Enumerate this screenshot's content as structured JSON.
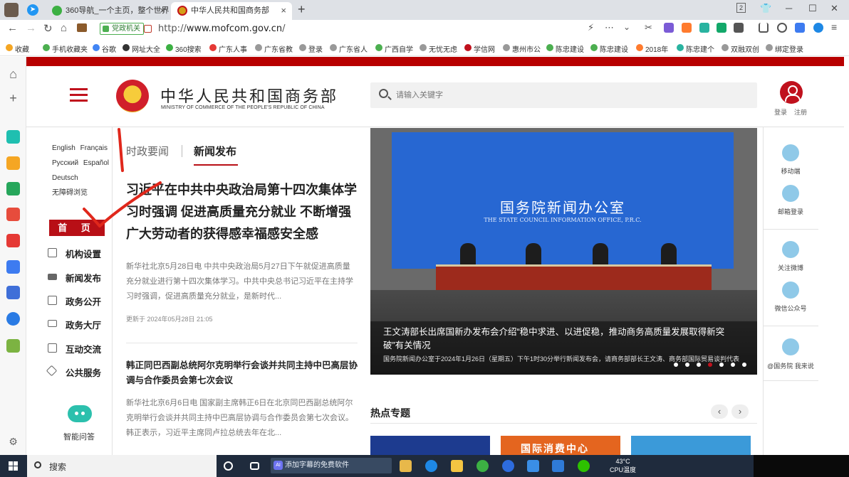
{
  "browser": {
    "tabs": [
      {
        "label": "360导航_一个主页，整个世界",
        "close": "×"
      },
      {
        "label": "中华人民共和国商务部",
        "close": "×"
      }
    ],
    "new_tab": "+",
    "tab_count": "2",
    "window_controls": [
      "─",
      "☐",
      "✕"
    ],
    "security_badge": "党政机关",
    "url_prefix": "http://",
    "url_host": "www.mofcom.gov.cn",
    "url_suffix": "/",
    "bookmarks": [
      "收藏",
      "手机收藏夹",
      "谷歌",
      "网址大全",
      "360搜索",
      "广东人事",
      "广东省教",
      "登录",
      "广东省人",
      "广西自学",
      "无忧无虑",
      "学信网",
      "惠州市公",
      "陈忠建设",
      "陈忠建设",
      "2018年",
      "陈忠建个",
      "双融双创",
      "绑定登录"
    ]
  },
  "site": {
    "logo_cn": "中华人民共和国商务部",
    "logo_en": "MINISTRY OF COMMERCE OF THE PEOPLE'S REPUBLIC OF CHINA",
    "search_placeholder": "请输入关键字",
    "login": "登录",
    "register": "注册",
    "languages": [
      "English",
      "Français",
      "Русский",
      "Español",
      "Deutsch",
      "无障碍浏览"
    ],
    "home": "首 页",
    "left_nav": [
      "机构设置",
      "新闻发布",
      "政务公开",
      "政务大厅",
      "互动交流",
      "公共服务"
    ],
    "ai_label": "智能问答",
    "news_tabs": [
      "时政要闻",
      "新闻发布"
    ],
    "headline": "习近平在中共中央政治局第十四次集体学习时强调 促进高质量充分就业 不断增强广大劳动者的获得感幸福感安全感",
    "summary": "新华社北京5月28日电 中共中央政治局5月27日下午就促进高质量充分就业进行第十四次集体学习。中共中央总书记习近平在主持学习时强调，促进高质量充分就业，是新时代...",
    "updated": "更新于 2024年05月28日 21:05",
    "headline2": "韩正同巴西副总统阿尔克明举行会谈并共同主持中巴高层协调与合作委员会第七次会议",
    "summary2": "新华社北京6月6日电 国家副主席韩正6日在北京同巴西副总统阿尔克明举行会谈并共同主持中巴高层协调与合作委员会第七次会议。 韩正表示，习近平主席同卢拉总统去年在北...",
    "hero": {
      "wall_cn": "国务院新闻办公室",
      "wall_en": "THE STATE COUNCIL INFORMATION OFFICE, P.R.C.",
      "caption_title": "王文涛部长出席国新办发布会介绍“稳中求进、以进促稳，推动商务高质量发展取得新突破”有关情况",
      "caption_desc": "国务院新闻办公室于2024年1月26日（星期五）下午1时30分举行新闻发布会，请商务部部长王文涛、商务部国际贸易谈判代表兼副部长王受文，副部长郭婷婷介绍稳中求进、以进促稳，推动商务高质量发展取得新突破有关情况，并答记者问。",
      "dot_count": 7,
      "active_dot": 3
    },
    "hot_title": "热点专题",
    "hot_prev": "‹",
    "hot_next": "›",
    "thumb_text": "国际消费中心",
    "right_links": [
      "移动端",
      "邮箱登录",
      "关注微博",
      "微信公众号",
      "@国务院 我来说"
    ]
  },
  "taskbar": {
    "search_placeholder": "搜索",
    "ai_box": "添加字幕的免费软件",
    "temperature": "43°C",
    "temp_label": "CPU温度"
  },
  "colors": {
    "brand_red": "#b80f16",
    "annotation_red": "#e0271b"
  }
}
